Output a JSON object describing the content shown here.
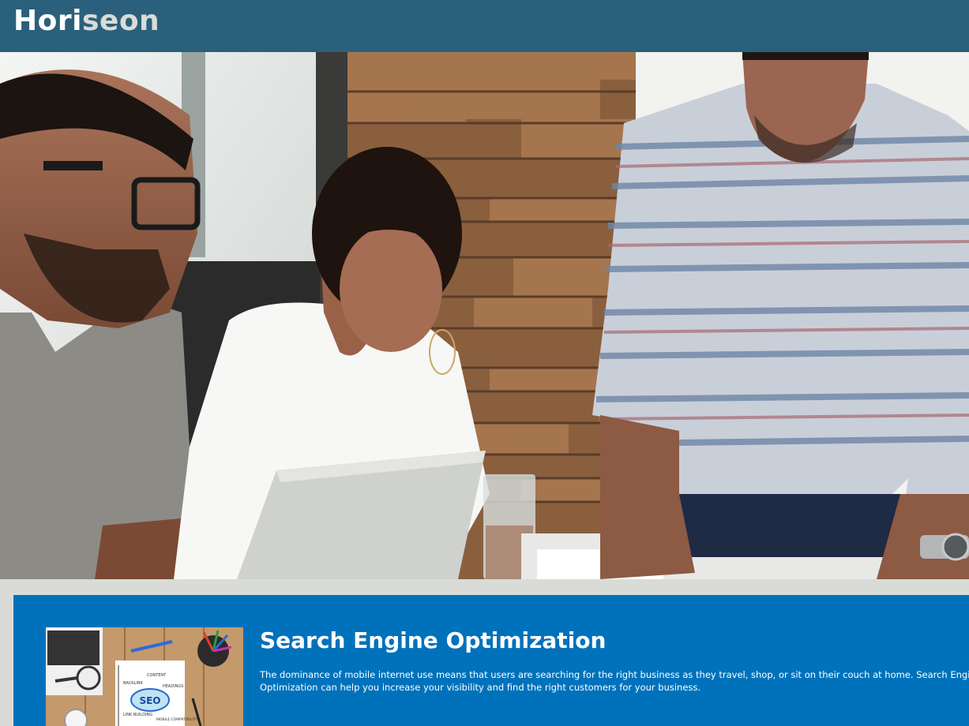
{
  "header": {
    "logo_main": "Hori",
    "logo_accent": "seon"
  },
  "hero": {
    "image": "team-meeting-photo"
  },
  "section": {
    "title": "Search Engine Optimization",
    "body": "The dominance of mobile internet use means that users are searching for the right business as they travel, shop, or sit on their couch at home. Search Engine Optimization can help you increase your visibility and find the right customers for your business.",
    "image": "seo-desk-photo",
    "image_text": {
      "seo": "SEO",
      "backlink": "BACKLINK",
      "content": "CONTENT",
      "headings": "HEADINGS",
      "link_building": "LINK BUILDING",
      "mobile_compatibility": "MOBILE COMPATIBILITY"
    }
  },
  "colors": {
    "header_bg": "#2a607c",
    "page_bg": "#d9dcd6",
    "section_bg": "#0072bb",
    "logo_accent": "#d9dcd6"
  }
}
